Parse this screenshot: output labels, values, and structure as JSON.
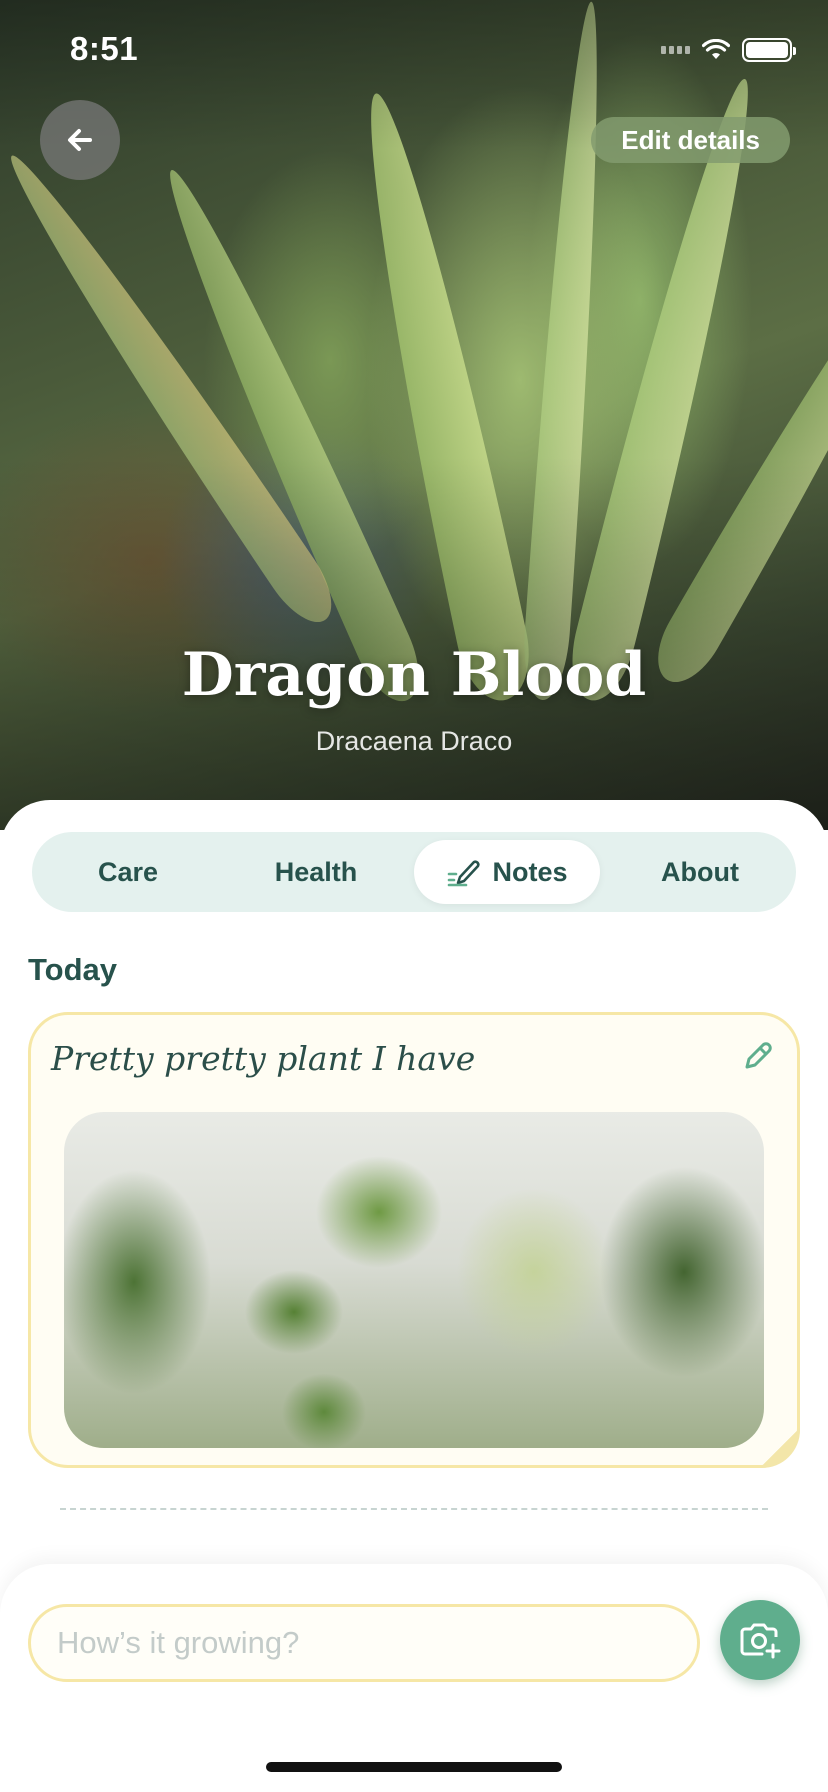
{
  "status_bar": {
    "time": "8:51"
  },
  "header": {
    "back_icon": "arrow-left-icon",
    "edit_label": "Edit details"
  },
  "plant": {
    "name": "Dragon Blood",
    "scientific_name": "Dracaena Draco"
  },
  "tabs": [
    {
      "label": "Care",
      "active": false
    },
    {
      "label": "Health",
      "active": false
    },
    {
      "label": "Notes",
      "active": true,
      "icon": "pencil-lines-icon"
    },
    {
      "label": "About",
      "active": false
    }
  ],
  "notes": {
    "section_title": "Today",
    "entries": [
      {
        "text": "Pretty pretty plant I have",
        "edit_icon": "pencil-icon",
        "has_photo": true
      }
    ]
  },
  "composer": {
    "placeholder": "How’s it growing?",
    "camera_icon": "camera-plus-icon"
  },
  "colors": {
    "accent_green": "#5fae8d",
    "text_dark_green": "#27524c",
    "tab_bg": "#e4f1ee",
    "note_border": "#f6e7a6"
  }
}
